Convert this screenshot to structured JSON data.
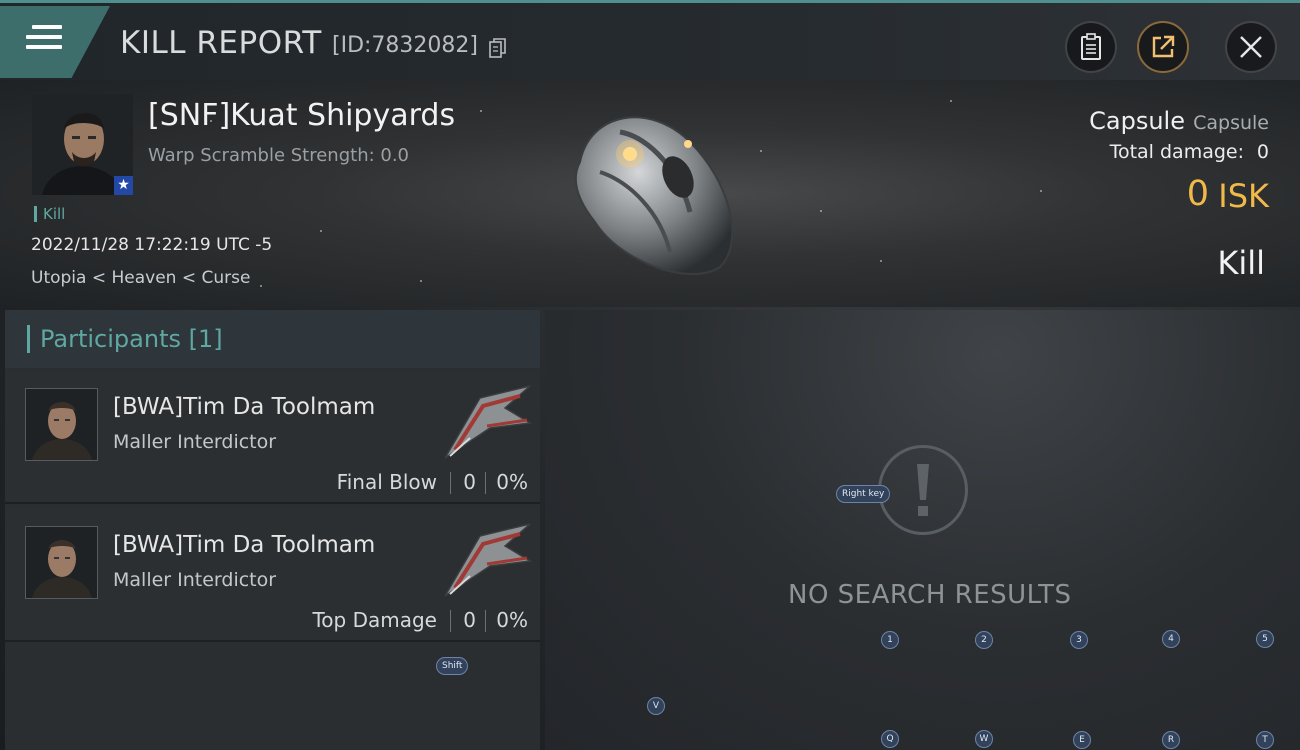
{
  "header": {
    "title": "KILL REPORT",
    "report_id": "[ID:7832082]"
  },
  "victim": {
    "name": "[SNF]Kuat Shipyards",
    "warp_scramble": "Warp Scramble Strength: 0.0",
    "kill_tag": "Kill",
    "datetime": "2022/11/28 17:22:19 UTC -5",
    "location": "Utopia < Heaven < Curse",
    "ship_name": "Capsule",
    "ship_type": "Capsule",
    "total_damage_label": "Total damage:",
    "total_damage_value": "0",
    "isk_value": "0",
    "isk_unit": "ISK",
    "result": "Kill"
  },
  "participants": {
    "title": "Participants [1]",
    "rows": [
      {
        "name": "[BWA]Tim Da Toolmam",
        "ship": "Maller Interdictor",
        "stat_label": "Final Blow",
        "damage": "0",
        "percent": "0%"
      },
      {
        "name": "[BWA]Tim Da Toolmam",
        "ship": "Maller Interdictor",
        "stat_label": "Top Damage",
        "damage": "0",
        "percent": "0%"
      }
    ]
  },
  "right_panel": {
    "no_results": "NO SEARCH RESULTS"
  },
  "key_hints": {
    "right_key": "Right key",
    "shift": "Shift",
    "k1": "1",
    "k2": "2",
    "k3": "3",
    "k4": "4",
    "k5": "5",
    "kv": "V",
    "kq": "Q",
    "kw": "W",
    "ke": "E",
    "kr": "R",
    "kt": "T"
  },
  "icons": {
    "menu": "menu-icon",
    "copy": "copy-icon",
    "clipboard": "clipboard-icon",
    "share": "share-icon",
    "close": "close-icon",
    "alert": "exclamation-icon",
    "badge": "star-badge-icon"
  },
  "colors": {
    "accent_teal": "#5fa8a2",
    "isk_gold": "#f0b94a",
    "tab_teal": "#3d6e6c"
  }
}
